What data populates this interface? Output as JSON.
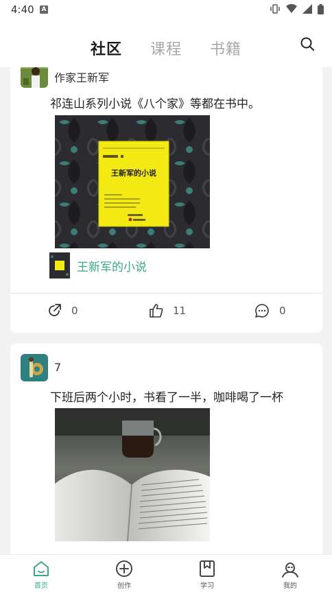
{
  "status": {
    "time": "4:40",
    "badge": "A"
  },
  "top_tabs": [
    "社区",
    "课程",
    "书籍"
  ],
  "posts": [
    {
      "username": "作家王新军",
      "text": "祁连山系列小说《八个家》等都在书中。",
      "book_cover_lines": [
        "文学创作与人格追求典藏 · 小说卷",
        "王新军 著",
        "王新军的小说"
      ],
      "book_title": "王新军的小说",
      "share_count": "0",
      "like_count": "11",
      "comment_count": "0"
    },
    {
      "username": "7",
      "text": "下班后两个小时，书看了一半，咖啡喝了一杯"
    }
  ],
  "bottom_nav": [
    "首页",
    "创作",
    "学习",
    "我的"
  ],
  "colors": {
    "accent": "#3aa885",
    "text": "#222222",
    "inactive_tab": "#a8a8a8"
  }
}
